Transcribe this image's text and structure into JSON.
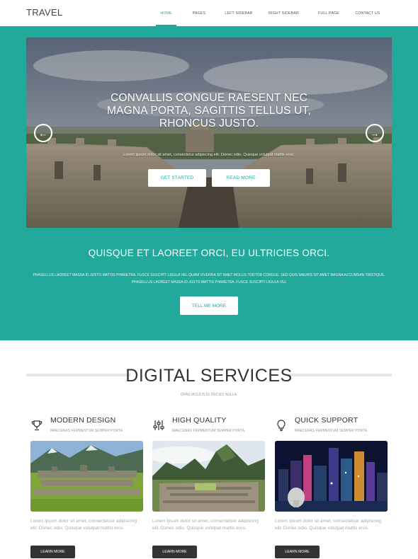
{
  "header": {
    "logo": "TRAVEL",
    "nav": [
      {
        "label": "HOME",
        "active": true
      },
      {
        "label": "PAGES",
        "active": false
      },
      {
        "label": "LEFT SIDEBAR",
        "active": false
      },
      {
        "label": "RIGHT SIDEBAR",
        "active": false
      },
      {
        "label": "FULL PAGE",
        "active": false
      },
      {
        "label": "CONTACT US",
        "active": false
      }
    ]
  },
  "hero": {
    "title": "CONVALLIS CONGUE RAESENT NEC MAGNA PORTA, SAGITTIS TELLUS UT, RHONCUS JUSTO.",
    "subtitle": "Lorem ipsum dolor sit amet, consectetur adipiscing elit. Donec odio. Quisque volutpat mattis eros.",
    "primary_button": "GET STARTED",
    "secondary_button": "READ MORE",
    "prev_icon": "arrow-left-circle-icon",
    "next_icon": "arrow-right-circle-icon"
  },
  "feature": {
    "title": "QUISQUE ET LAOREET ORCI, EU ULTRICIES ORCI.",
    "text": "PHASELLUS LAOREET MASSA ID JUSTO MATTIS PHARETRA. FUSCE SUSCIPIT LIGULA VEL QUAM VIVERRA SIT AMET MOLLIS TORTOR CONGUE. SED QUIS MAURIS SIT AMET MAGNA ACCUMSAN TRISTIQUE. PHASELLUS LAOREET MASSA ID JUSTO MATTIS PHARETRA. FUSCE SUSCIPIT LIGULA VEL",
    "button": "TELL ME MORE"
  },
  "services": {
    "title": "DIGITAL SERVICES",
    "subtitle": "CRAS IACULIS ULTRICIES NULLA.",
    "cards": [
      {
        "icon": "trophy-icon",
        "title": "MODERN DESIGN",
        "subtitle": "MAECENAS FERMENTUM SEMPER PORTA.",
        "text": "Lorem ipsum dolor sit amet, consectetuer adipiscing elit. Donec odio. Quisque volutpat mattis eros.",
        "button": "LEARN MORE"
      },
      {
        "icon": "sliders-icon",
        "title": "HIGH QUALITY",
        "subtitle": "MAECENAS FERMENTUM SEMPER PORTA.",
        "text": "Lorem ipsum dolor sit amet, consectetuer adipiscing elit. Donec odio. Quisque volutpat mattis eros.",
        "button": "LEARN MORE"
      },
      {
        "icon": "lightbulb-icon",
        "title": "QUICK SUPPORT",
        "subtitle": "MAECENAS FERMENTUM SEMPER PORTA.",
        "text": "Lorem ipsum dolor sit amet, consectetuer adipiscing elit. Donec odio. Quisque volutpat mattis eros.",
        "button": "LEARN MORE"
      }
    ]
  },
  "colors": {
    "accent": "#22a99b",
    "dark_button": "#333333"
  }
}
